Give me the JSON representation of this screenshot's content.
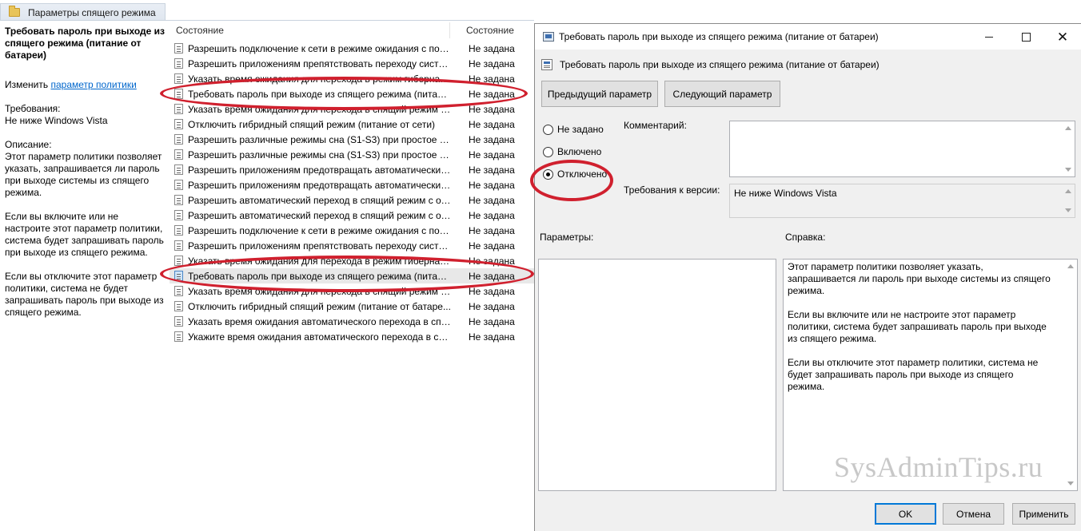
{
  "left": {
    "tab_title": "Параметры спящего режима",
    "description": {
      "title": "Требовать пароль при выходе из спящего режима (питание от батареи)",
      "edit_prefix": "Изменить ",
      "edit_link": "параметр политики",
      "requirements_label": "Требования:",
      "requirements_value": "Не ниже Windows Vista",
      "description_label": "Описание:",
      "paragraph1": "Этот параметр политики позволяет указать, запрашивается ли пароль при выходе системы из спящего режима.",
      "paragraph2": "Если вы включите или не настроите этот параметр политики, система будет запрашивать пароль при выходе из спящего режима.",
      "paragraph3": "Если вы отключите этот параметр политики, система не будет запрашивать пароль при выходе из спящего режима."
    },
    "list": {
      "col_name": "Состояние",
      "col_state": "Состояние",
      "rows": [
        {
          "name": "Разрешить подключение к сети в режиме ожидания с пос...",
          "state": "Не задана"
        },
        {
          "name": "Разрешить приложениям препятствовать переходу систем...",
          "state": "Не задана"
        },
        {
          "name": "Указать время ожидания для перехода в режим гибернации...",
          "state": "Не задана"
        },
        {
          "name": "Требовать пароль при выходе из спящего режима (питание...",
          "state": "Не задана"
        },
        {
          "name": "Указать время ожидания для перехода в спящий режим (пит...",
          "state": "Не задана"
        },
        {
          "name": "Отключить гибридный спящий режим (питание от сети)",
          "state": "Не задана"
        },
        {
          "name": "Разрешить различные режимы сна (S1-S3) при простое ком...",
          "state": "Не задана"
        },
        {
          "name": "Разрешить различные режимы сна (S1-S3) при простое ком...",
          "state": "Не задана"
        },
        {
          "name": "Разрешить приложениям предотвращать автоматический ...",
          "state": "Не задана"
        },
        {
          "name": "Разрешить приложениям предотвращать автоматический ...",
          "state": "Не задана"
        },
        {
          "name": "Разрешить автоматический переход в спящий режим с от...",
          "state": "Не задана"
        },
        {
          "name": "Разрешить автоматический переход в спящий режим с от...",
          "state": "Не задана"
        },
        {
          "name": "Разрешить подключение к сети в режиме ожидания с пос...",
          "state": "Не задана"
        },
        {
          "name": "Разрешить приложениям препятствовать переходу систем...",
          "state": "Не задана"
        },
        {
          "name": "Указать время ожидания для перехода в режим гибернации...",
          "state": "Не задана"
        },
        {
          "name": "Требовать пароль при выходе из спящего режима (питани...",
          "state": "Не задана"
        },
        {
          "name": "Указать время ожидания для перехода в спящий режим (пит...",
          "state": "Не задана"
        },
        {
          "name": "Отключить гибридный спящий режим (питание от батаре...",
          "state": "Не задана"
        },
        {
          "name": "Указать время ожидания автоматического перехода в спя...",
          "state": "Не задана"
        },
        {
          "name": "Укажите время ожидания автоматического перехода в спя...",
          "state": "Не задана"
        }
      ]
    }
  },
  "dialog": {
    "title": "Требовать пароль при выходе из спящего режима (питание от батареи)",
    "header": "Требовать пароль при выходе из спящего режима (питание от батареи)",
    "prev_button": "Предыдущий параметр",
    "next_button": "Следующий параметр",
    "radio_not_set": "Не задано",
    "radio_enabled": "Включено",
    "radio_disabled": "Отключено",
    "comment_label": "Комментарий:",
    "version_label": "Требования к версии:",
    "version_value": "Не ниже Windows Vista",
    "params_label": "Параметры:",
    "help_label": "Справка:",
    "help_p1": "Этот параметр политики позволяет указать, запрашивается ли пароль при выходе системы из спящего режима.",
    "help_p2": "Если вы включите или не настроите этот параметр политики, система будет запрашивать пароль при выходе из спящего режима.",
    "help_p3": "Если вы отключите этот параметр политики, система не будет запрашивать пароль при выходе из спящего режима.",
    "ok_button": "OK",
    "cancel_button": "Отмена",
    "apply_button": "Применить",
    "selected_option": "Отключено"
  },
  "watermark": "SysAdminTips.ru",
  "colors": {
    "annotation": "#d0202e",
    "link": "#0066cc",
    "dialog_bg": "#f0f0f0"
  }
}
